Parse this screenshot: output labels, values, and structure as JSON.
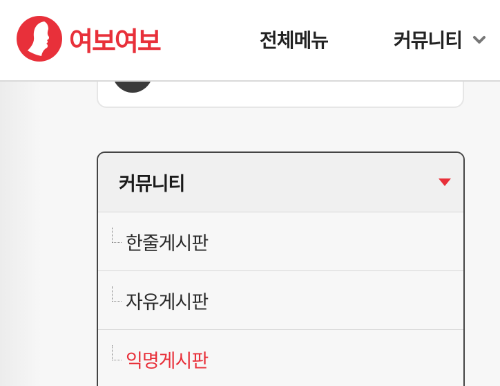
{
  "brand": {
    "name": "여보여보",
    "color": "#e8303a"
  },
  "nav": {
    "all_menu": "전체메뉴",
    "community": "커뮤니티"
  },
  "sidebar": {
    "title": "커뮤니티",
    "items": [
      {
        "label": "한줄게시판",
        "active": false
      },
      {
        "label": "자유게시판",
        "active": false
      },
      {
        "label": "익명게시판",
        "active": true
      }
    ]
  },
  "icons": {
    "logo": "woman-profile-logo-icon",
    "nav_dropdown": "chevron-down-icon",
    "panel_toggle": "caret-down-icon",
    "tree_branch": "tree-branch-icon"
  }
}
